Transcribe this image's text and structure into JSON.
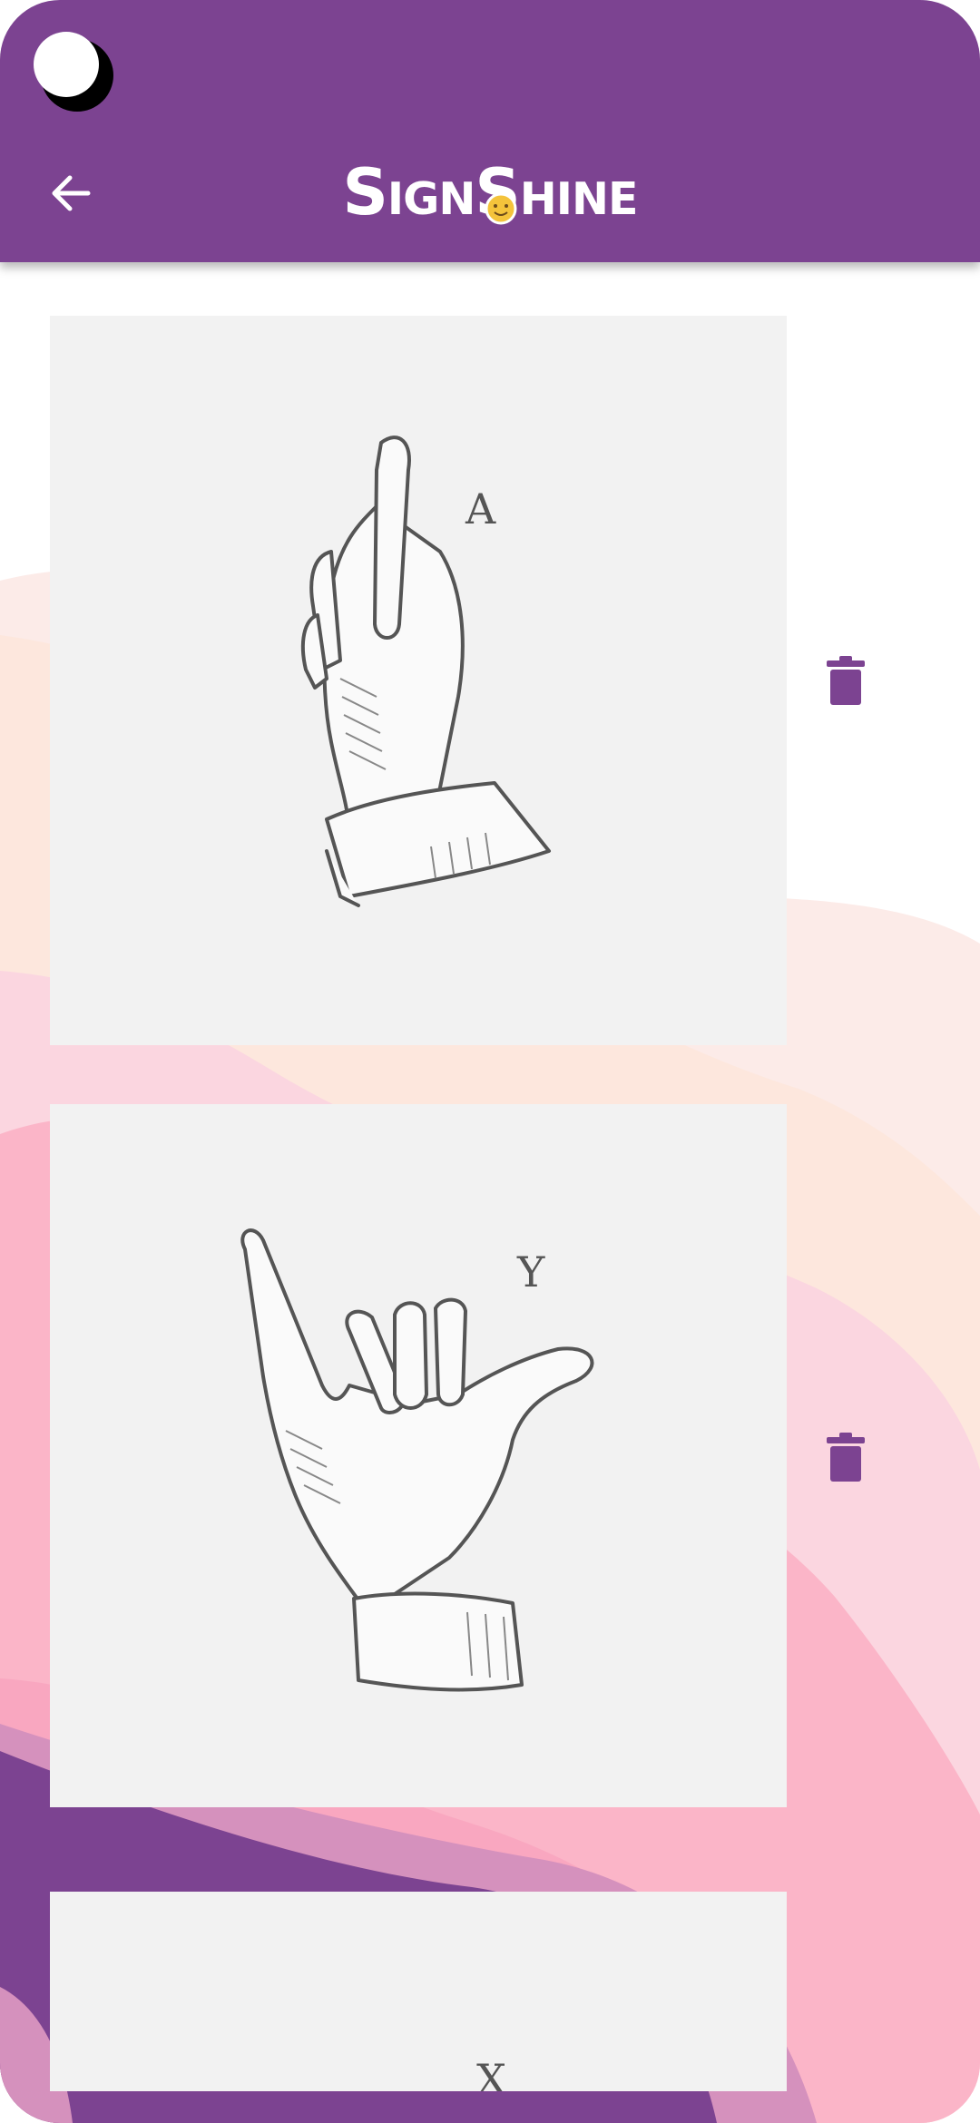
{
  "app": {
    "title": "SignShine",
    "header_color": "#7c4391",
    "accent_color": "#7c4391"
  },
  "header": {
    "back_icon": "arrow-left-icon",
    "logo_icon": "sun-icon"
  },
  "signs": [
    {
      "letter": "A",
      "delete_icon": "trash-icon"
    },
    {
      "letter": "Y",
      "delete_icon": "trash-icon"
    },
    {
      "letter": "X",
      "delete_icon": "trash-icon"
    }
  ]
}
